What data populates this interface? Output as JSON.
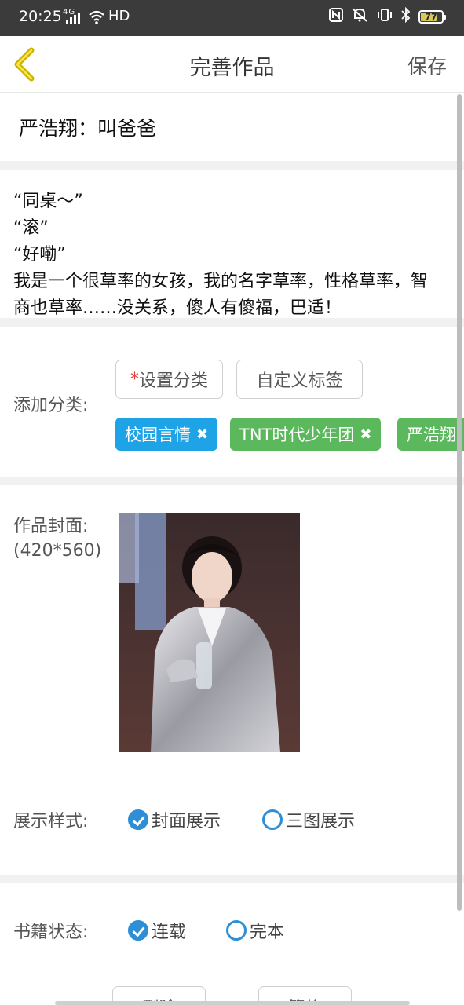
{
  "status_bar": {
    "time": "20:25",
    "network": "4G",
    "hd": "HD",
    "battery": "77"
  },
  "nav": {
    "title": "完善作品",
    "save_label": "保存"
  },
  "work": {
    "title": "严浩翔：叫爸爸",
    "intro_lines": [
      "“同桌～”",
      "“滚”",
      "“好嘞”",
      "我是一个很草率的女孩，我的名字草率，性格草率，智",
      "商也草率……没关系，傻人有傻福，巴适！"
    ]
  },
  "category": {
    "label": "添加分类:",
    "set_category_star": "*",
    "set_category_label": "设置分类",
    "custom_tag_label": "自定义标签",
    "tags": [
      "校园言情",
      "TNT时代少年团",
      "严浩翔"
    ],
    "tag_close": "✖"
  },
  "cover": {
    "label_line1": "作品封面:",
    "label_line2": "(420*560)"
  },
  "display_style": {
    "label": "展示样式:",
    "options": [
      "封面展示",
      "三图展示"
    ],
    "selected": "封面展示"
  },
  "book_status": {
    "label": "书籍状态:",
    "options": [
      "连载",
      "完本"
    ],
    "selected": "连载"
  },
  "bottom_buttons": {
    "delete_label": "删除",
    "sign_label": "签约"
  },
  "colors": {
    "accent_blue": "#2e8fd6",
    "tag_blue": "#1ea3e6",
    "tag_green": "#5cb85c",
    "back_arrow": "#c9b400",
    "required_star": "#e23b3b"
  }
}
